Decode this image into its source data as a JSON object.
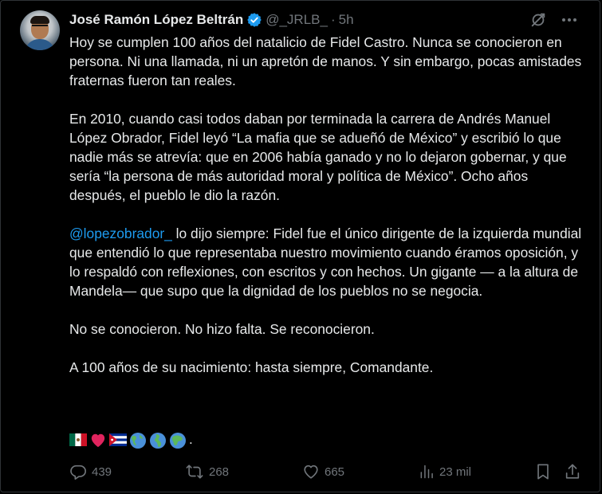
{
  "author": {
    "name": "José Ramón López Beltrán",
    "handle": "@_JRLB_",
    "separator": "·",
    "time": "5h"
  },
  "tweet": {
    "p1": "Hoy se cumplen 100 años del natalicio de Fidel Castro. Nunca se conocieron en persona. Ni una llamada, ni un apretón de manos. Y sin embargo, pocas amistades fraternas fueron tan reales.",
    "p2": "En 2010, cuando casi todos daban por terminada la carrera de Andrés Manuel López Obrador, Fidel leyó “La mafia que se adueñó de México” y escribió lo que nadie más se atrevía: que en 2006 había ganado y no lo dejaron gobernar, y que sería “la persona de más autoridad moral y política de México”. Ocho años después, el pueblo le dio la razón.",
    "p3_mention": "@lopezobrador_",
    "p3_rest": " lo dijo siempre: Fidel fue el único dirigente de la izquierda mundial que entendió lo que representaba nuestro movimiento cuando éramos oposición, y lo respaldó con reflexiones, con escritos y con hechos. Un gigante — a la altura de Mandela— que supo que la dignidad de los pueblos no se negocia.",
    "p4": "No se conocieron. No hizo falta. Se reconocieron.",
    "p5": "A 100 años de su nacimiento: hasta siempre, Comandante.",
    "emoji_trailing": "."
  },
  "actions": {
    "replies": "439",
    "reposts": "268",
    "likes": "665",
    "views": "23 mil"
  },
  "colors": {
    "background": "#000000",
    "text": "#e7e9ea",
    "muted": "#71767b",
    "link": "#1d9bf0",
    "verified": "#1d9bf0"
  },
  "icons": {
    "verified": "verified-badge-icon",
    "grok": "grok-icon",
    "more": "more-icon",
    "reply": "reply-icon",
    "repost": "repost-icon",
    "like": "heart-icon",
    "views": "views-icon",
    "bookmark": "bookmark-icon",
    "share": "share-icon",
    "emojis": [
      "mexico-flag-icon",
      "red-heart-icon",
      "cuba-flag-icon",
      "globe-americas-icon",
      "globe-europe-africa-icon",
      "globe-asia-icon"
    ]
  }
}
